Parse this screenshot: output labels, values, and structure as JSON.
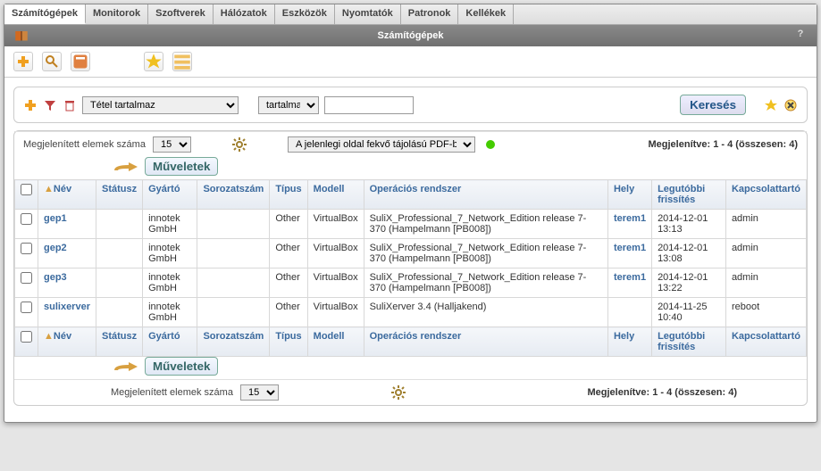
{
  "nav": {
    "tabs": [
      "Számítógépek",
      "Monitorok",
      "Szoftverek",
      "Hálózatok",
      "Eszközök",
      "Nyomtatók",
      "Patronok",
      "Kellékek"
    ],
    "active": "Számítógépek"
  },
  "title": "Számítógépek",
  "search": {
    "field_select": "Tétel tartalmaz",
    "op_select": "tartalmaz",
    "value": "",
    "button": "Keresés"
  },
  "pager": {
    "count_label": "Megjelenített elemek száma",
    "count_value": "15",
    "pdf_select": "A jelenlegi oldal fekvő tájolású PDF-ben",
    "display_text": "Megjelenítve: 1 - 4 (összesen: 4)"
  },
  "ops_button": "Műveletek",
  "columns": [
    "Név",
    "Státusz",
    "Gyártó",
    "Sorozatszám",
    "Típus",
    "Modell",
    "Operációs rendszer",
    "Hely",
    "Legutóbbi frissítés",
    "Kapcsolattartó"
  ],
  "rows": [
    {
      "name": "gep1",
      "status": "",
      "manufacturer": "innotek GmbH",
      "serial": "",
      "type": "Other",
      "model": "VirtualBox",
      "os": "SuliX_Professional_7_Network_Edition release 7-370 (Hampelmann [PB008])",
      "location": "terem1",
      "updated": "2014-12-01 13:13",
      "contact": "admin"
    },
    {
      "name": "gep2",
      "status": "",
      "manufacturer": "innotek GmbH",
      "serial": "",
      "type": "Other",
      "model": "VirtualBox",
      "os": "SuliX_Professional_7_Network_Edition release 7-370 (Hampelmann [PB008])",
      "location": "terem1",
      "updated": "2014-12-01 13:08",
      "contact": "admin"
    },
    {
      "name": "gep3",
      "status": "",
      "manufacturer": "innotek GmbH",
      "serial": "",
      "type": "Other",
      "model": "VirtualBox",
      "os": "SuliX_Professional_7_Network_Edition release 7-370 (Hampelmann [PB008])",
      "location": "terem1",
      "updated": "2014-12-01 13:22",
      "contact": "admin"
    },
    {
      "name": "sulixerver",
      "status": "",
      "manufacturer": "innotek GmbH",
      "serial": "",
      "type": "Other",
      "model": "VirtualBox",
      "os": "SuliXerver 3.4 (Halljakend)",
      "location": "",
      "updated": "2014-11-25 10:40",
      "contact": "reboot"
    }
  ]
}
